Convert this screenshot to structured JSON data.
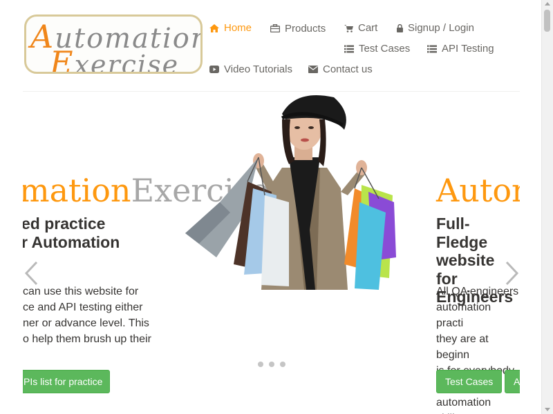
{
  "logo": {
    "line1_cap": "A",
    "line1_rest": "utomation",
    "line2_cap": "E",
    "line2_rest": "xercise",
    "alt": "Automation Exercise"
  },
  "nav": {
    "home": "Home",
    "products": "Products",
    "cart": "Cart",
    "signup": "Signup / Login",
    "test_cases": "Test Cases",
    "api_testing": "API Testing",
    "video_tutorials": "Video Tutorials",
    "contact_us": "Contact us",
    "icons": {
      "home": "home-icon",
      "products": "briefcase-icon",
      "cart": "cart-icon",
      "signup": "lock-icon",
      "test_cases": "list-icon",
      "api_testing": "list-icon",
      "video_tutorials": "youtube-play-icon",
      "contact_us": "envelope-icon"
    }
  },
  "slider": {
    "left_slide": {
      "title_a": "mation",
      "title_b": "Exercise",
      "subtitle_line1": "ed practice",
      "subtitle_line2": "r Automation",
      "desc_line1": "can use this website for",
      "desc_line2": "ce and API testing either",
      "desc_line3": "ner or advance level. This",
      "desc_line4": "o help them brush up their",
      "button": "PIs list for practice"
    },
    "right_slide": {
      "title_a": "Autom",
      "subtitle_line1": "Full-Fledge",
      "subtitle_line2": "website for",
      "subtitle_line3": "Engineers",
      "desc_line1": "All QA engineers",
      "desc_line2": "automation practi",
      "desc_line3": "they are at beginn",
      "desc_line4": "is for everybody t",
      "desc_line5": "automation skills.",
      "button1": "Test Cases",
      "button2": "A"
    },
    "dots_count": 3,
    "prev_icon": "chevron-left-icon",
    "next_icon": "chevron-right-icon"
  },
  "colors": {
    "accent": "#FE980F",
    "brand_grey": "#a7a7a7",
    "button_green": "#5cb85c",
    "text_dark": "#363432",
    "nav_text": "#696763"
  }
}
